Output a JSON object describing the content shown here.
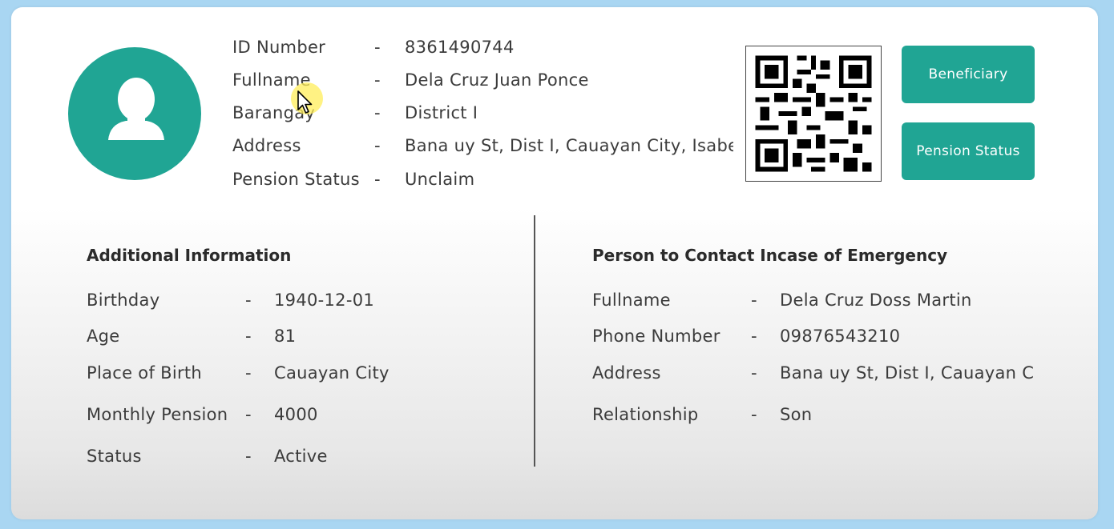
{
  "profile": {
    "rows": [
      {
        "label": "ID Number",
        "value": "8361490744"
      },
      {
        "label": "Fullname",
        "value": "Dela Cruz Juan Ponce"
      },
      {
        "label": "Barangay",
        "value": "District I"
      },
      {
        "label": "Address",
        "value": "Bana uy St, Dist I, Cauayan City, Isabela"
      },
      {
        "label": "Pension Status",
        "value": "Unclaim"
      }
    ],
    "separator": "-"
  },
  "buttons": {
    "beneficiary": "Beneficiary",
    "pension_status": "Pension Status"
  },
  "additional": {
    "title": "Additional Information",
    "rows": [
      {
        "label": "Birthday",
        "value": "1940-12-01"
      },
      {
        "label": "Age",
        "value": "81"
      },
      {
        "label": "Place of Birth",
        "value": "Cauayan City"
      },
      {
        "label": "Monthly Pension",
        "value": "4000"
      },
      {
        "label": "Status",
        "value": "Active"
      }
    ]
  },
  "emergency": {
    "title": "Person to Contact Incase of Emergency",
    "rows": [
      {
        "label": "Fullname",
        "value": "Dela Cruz Doss Martin"
      },
      {
        "label": "Phone Number",
        "value": "09876543210"
      },
      {
        "label": "Address",
        "value": "Bana uy St, Dist I, Cauayan C"
      },
      {
        "label": "Relationship",
        "value": "Son"
      }
    ]
  },
  "icons": {
    "avatar": "user-silhouette-icon",
    "qr": "qr-code-icon",
    "cursor": "mouse-pointer-icon"
  },
  "colors": {
    "accent": "#20a594",
    "background": "#a9d6f2",
    "text": "#3b3b3b"
  }
}
